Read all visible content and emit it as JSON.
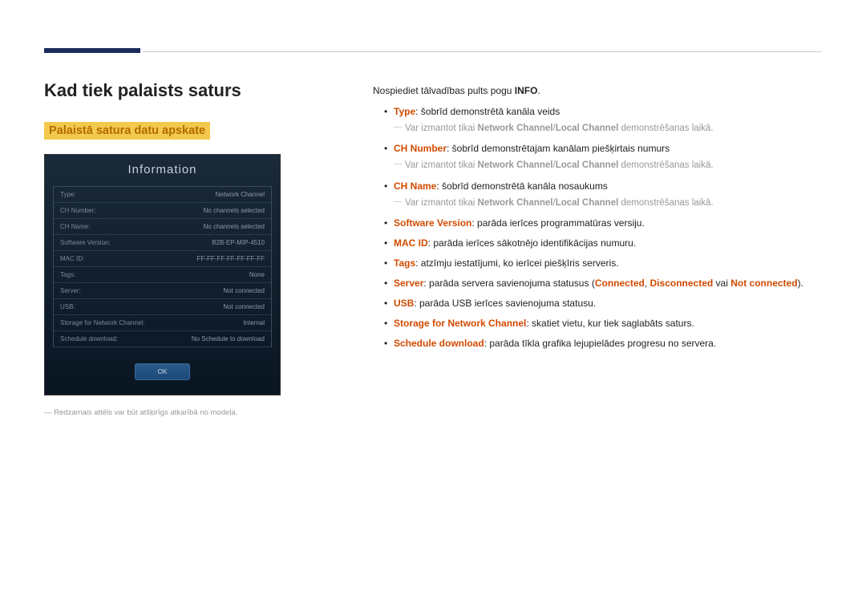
{
  "heading": "Kad tiek palaists saturs",
  "section_title": "Palaistā satura datu apskate",
  "device": {
    "title": "Information",
    "rows": [
      {
        "label": "Type:",
        "value": "Network Channel"
      },
      {
        "label": "CH Number:",
        "value": "No channels selected"
      },
      {
        "label": "CH Name:",
        "value": "No channels selected"
      },
      {
        "label": "Software Version:",
        "value": "B2B-EP-MIP-4510"
      },
      {
        "label": "MAC ID:",
        "value": "FF-FF-FF-FF-FF-FF-FF"
      },
      {
        "label": "Tags:",
        "value": "None"
      },
      {
        "label": "Server:",
        "value": "Not connected"
      },
      {
        "label": "USB:",
        "value": "Not connected"
      },
      {
        "label": "Storage for Network Channel:",
        "value": "Internal"
      },
      {
        "label": "Schedule download:",
        "value": "No Schedule to download"
      }
    ],
    "ok": "OK"
  },
  "footnote_dash": "―",
  "footnote": "Redzamais attēls var būt atšķirīgs atkarībā no modeļa.",
  "intro_pre": "Nospiediet tālvadības pults pogu ",
  "intro_bold": "INFO",
  "intro_post": ".",
  "items": {
    "type": {
      "label": "Type",
      "desc": ": šobrīd demonstrētā kanāla veids"
    },
    "chnum": {
      "label": "CH Number",
      "desc": ": šobrīd demonstrētajam kanālam piešķirtais numurs"
    },
    "chname": {
      "label": "CH Name",
      "desc": ": šobrīd demonstrētā kanāla nosaukums"
    },
    "subnote": {
      "pre": "Var izmantot tikai ",
      "hl1": "Network Channel",
      "sep": "/",
      "hl2": "Local Channel",
      "post": " demonstrēšanas laikā."
    },
    "swver": {
      "label": "Software Version",
      "desc": ": parāda ierīces programmatūras versiju."
    },
    "macid": {
      "label": "MAC ID",
      "desc": ": parāda ierīces sākotnējo identifikācijas numuru."
    },
    "tags": {
      "label": "Tags",
      "desc": ": atzīmju iestatījumi, ko ierīcei piešķīris serveris."
    },
    "server": {
      "label": "Server",
      "pre": ": parāda servera savienojuma statusus (",
      "s1": "Connected",
      "c1": ", ",
      "s2": "Disconnected",
      "c2": " vai ",
      "s3": "Not connected",
      "post": ")."
    },
    "usb": {
      "label": "USB",
      "desc": ": parāda USB ierīces savienojuma statusu."
    },
    "storage": {
      "label": "Storage for Network Channel",
      "desc": ": skatiet vietu, kur tiek saglabāts saturs."
    },
    "sched": {
      "label": "Schedule download",
      "desc": ": parāda tīkla grafika lejupielādes progresu no servera."
    }
  }
}
